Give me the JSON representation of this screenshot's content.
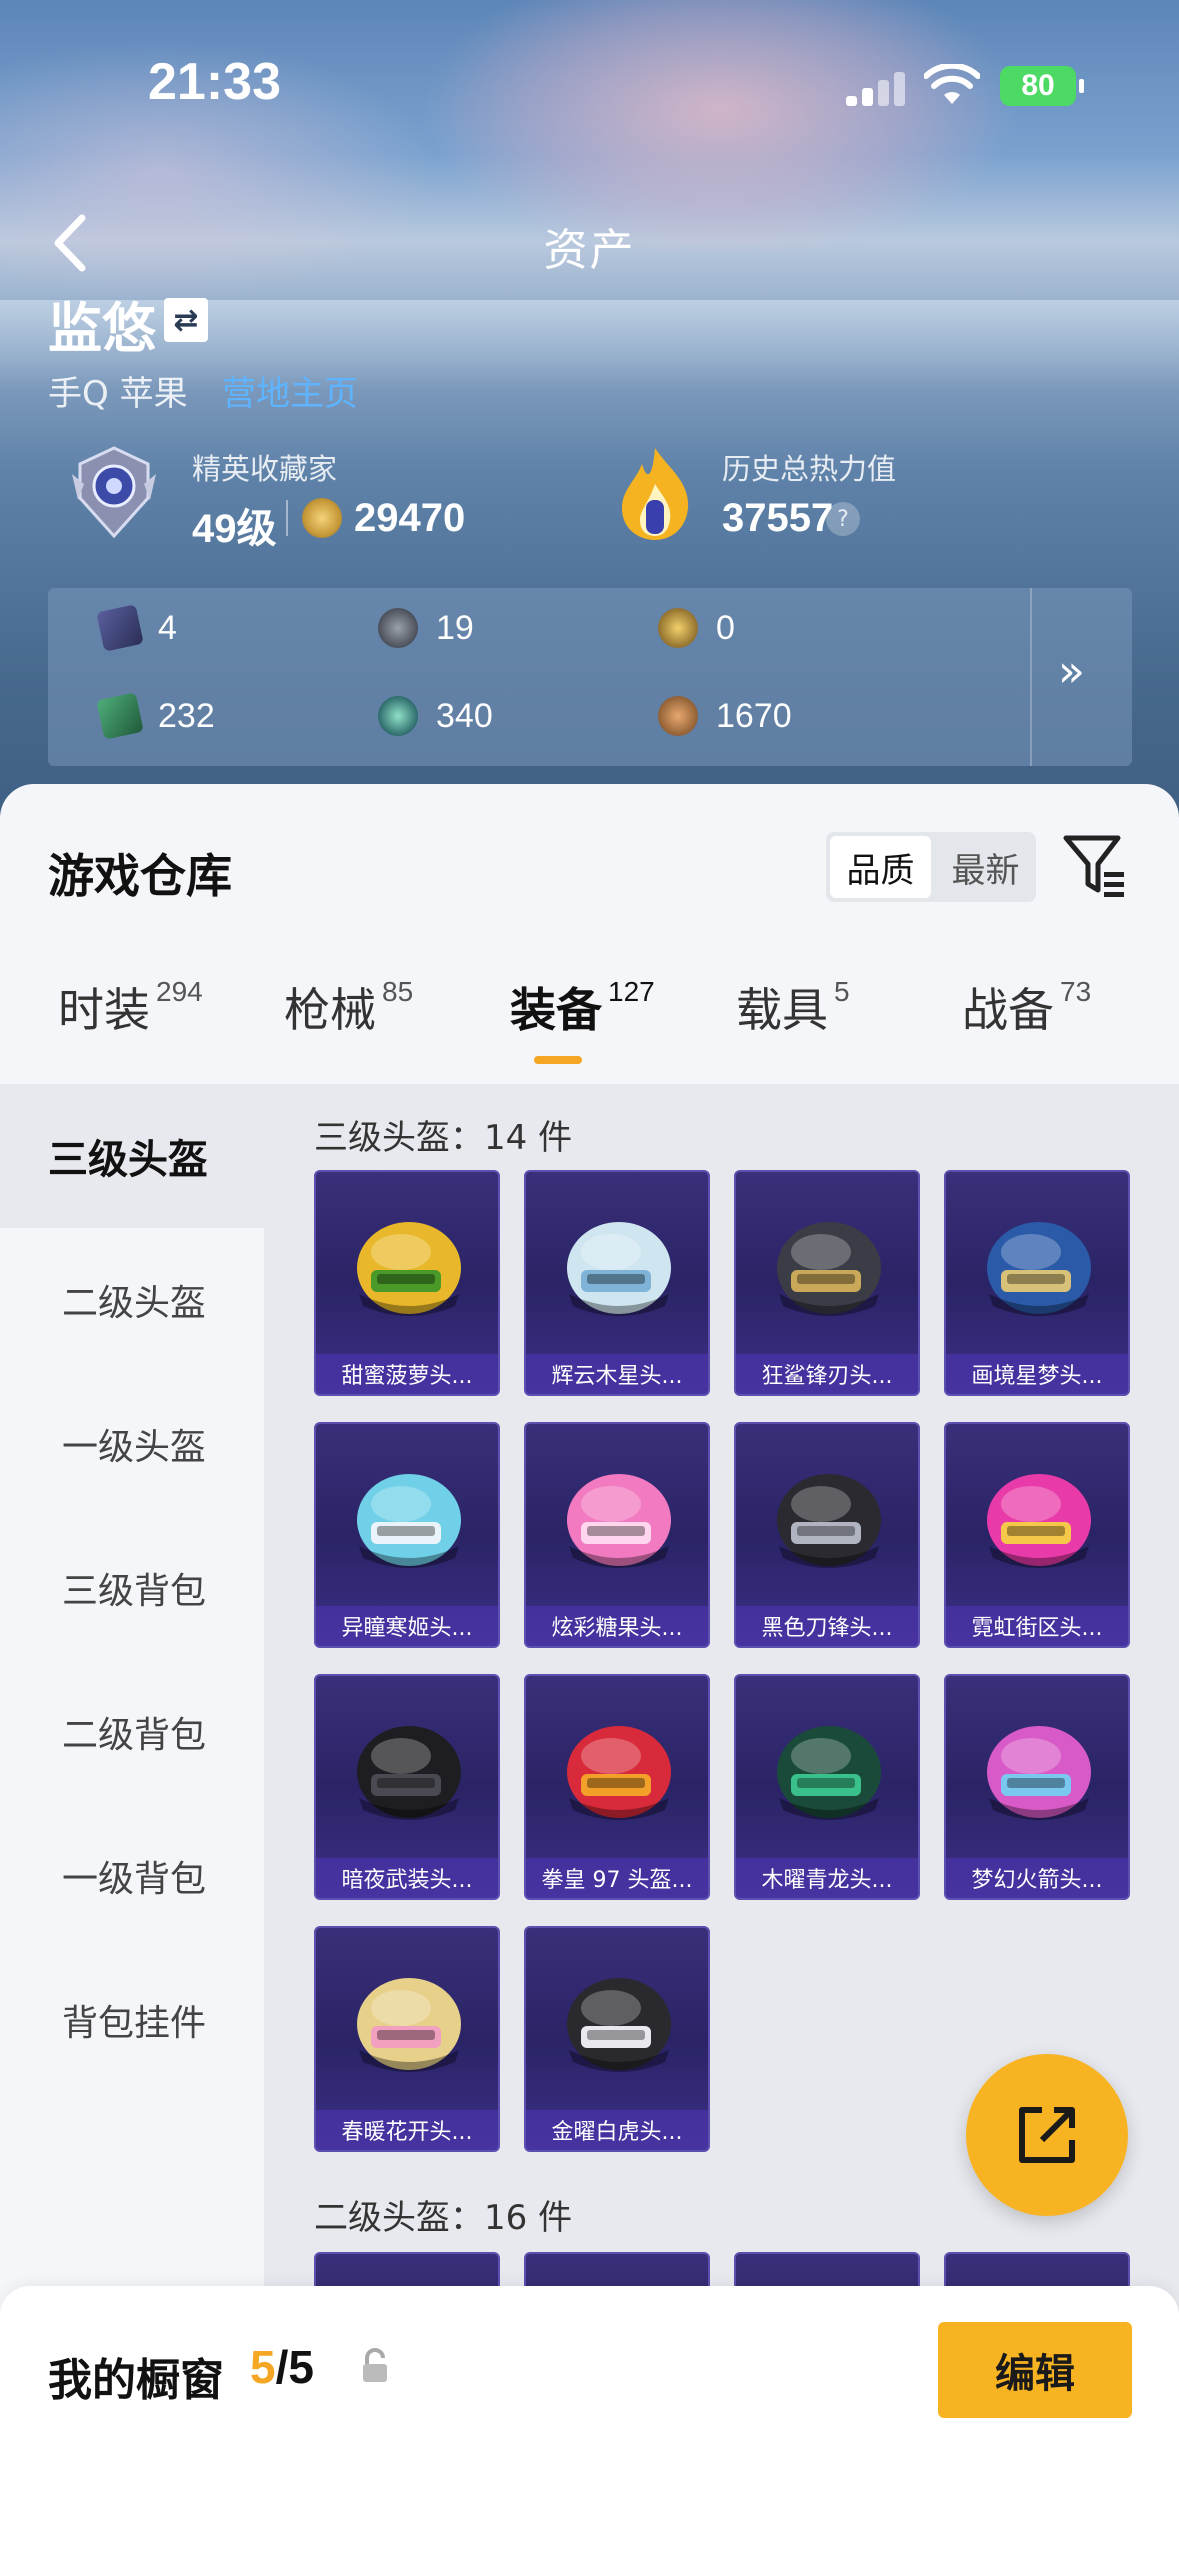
{
  "status": {
    "time": "21:33",
    "battery": "80"
  },
  "nav": {
    "title": "资产"
  },
  "profile": {
    "name": "监悠",
    "platform": "手Q 苹果",
    "platform_link": "营地主页"
  },
  "stats": {
    "collector_label": "精英收藏家",
    "level": "49级",
    "coins": "29470",
    "heat_label": "历史总热力值",
    "heat_value": "37557",
    "help": "?"
  },
  "currencies": [
    {
      "icon": "card-icon",
      "value": "4",
      "color": "#3a3f6e"
    },
    {
      "icon": "s-coin-icon",
      "value": "19",
      "color": "#4a4f5a"
    },
    {
      "icon": "gold-coin-icon",
      "value": "0",
      "color": "#8a6a2a"
    },
    {
      "icon": "green-card-icon",
      "value": "232",
      "color": "#2a6a4a"
    },
    {
      "icon": "orb-icon",
      "value": "340",
      "color": "#2d6b6b"
    },
    {
      "icon": "bronze-coin-icon",
      "value": "1670",
      "color": "#8a5a30"
    }
  ],
  "expand_glyph": "»",
  "warehouse": {
    "title": "游戏仓库",
    "sort": [
      "品质",
      "最新"
    ],
    "tabs": [
      {
        "label": "时装",
        "count": "294"
      },
      {
        "label": "枪械",
        "count": "85"
      },
      {
        "label": "装备",
        "count": "127"
      },
      {
        "label": "载具",
        "count": "5"
      },
      {
        "label": "战备",
        "count": "73"
      }
    ],
    "categories": [
      "三级头盔",
      "二级头盔",
      "一级头盔",
      "三级背包",
      "二级背包",
      "一级背包",
      "背包挂件"
    ],
    "section1": {
      "title": "三级头盔：14 件"
    },
    "items": [
      {
        "name": "甜蜜菠萝头...",
        "color": "#e8b82a",
        "accent": "#4a9a2a"
      },
      {
        "name": "辉云木星头...",
        "color": "#cfe6f0",
        "accent": "#7fb4d8"
      },
      {
        "name": "狂鲨锋刃头...",
        "color": "#3a3d46",
        "accent": "#c9a85a"
      },
      {
        "name": "画境星梦头...",
        "color": "#2a5aa8",
        "accent": "#d8c27a"
      },
      {
        "name": "异瞳寒姬头...",
        "color": "#6fd0e8",
        "accent": "#e8f4fa"
      },
      {
        "name": "炫彩糖果头...",
        "color": "#f27ac0",
        "accent": "#ffd6ee"
      },
      {
        "name": "黑色刀锋头...",
        "color": "#2a2a30",
        "accent": "#b0b4c0"
      },
      {
        "name": "霓虹街区头...",
        "color": "#e83aa8",
        "accent": "#f6c84a"
      },
      {
        "name": "暗夜武装头...",
        "color": "#1e1e22",
        "accent": "#4a4a52"
      },
      {
        "name": "拳皇 97 头盔...",
        "color": "#d82a3a",
        "accent": "#f2a02a"
      },
      {
        "name": "木曜青龙头...",
        "color": "#1a4a3a",
        "accent": "#3ac08a"
      },
      {
        "name": "梦幻火箭头...",
        "color": "#d85ac8",
        "accent": "#7ac8f0"
      },
      {
        "name": "春暖花开头...",
        "color": "#e6d08a",
        "accent": "#f2a0c0"
      },
      {
        "name": "金曜白虎头...",
        "color": "#2a2a2e",
        "accent": "#e8e8ee"
      }
    ],
    "section2": {
      "title": "二级头盔：16 件"
    }
  },
  "showcase": {
    "label": "我的橱窗",
    "used": "5",
    "total": "/5",
    "edit": "编辑"
  },
  "colors": {
    "accent": "#f7b321",
    "tab_underline": "#f5a623",
    "link": "#5fb4ff"
  }
}
